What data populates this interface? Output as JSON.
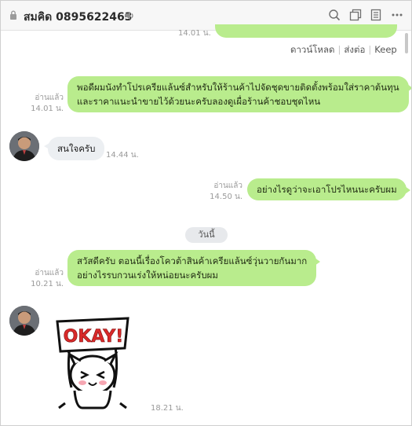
{
  "header": {
    "title": "สมคิด 0895622463",
    "icons": [
      "lock-icon",
      "speaker-icon",
      "search-icon",
      "copy-icon",
      "notes-icon",
      "more-icon"
    ]
  },
  "file_message": {
    "time": "14.01 น.",
    "actions": [
      "ดาวน์โหลด",
      "ส่งต่อ",
      "Keep"
    ]
  },
  "messages": [
    {
      "sender": "me",
      "read": "อ่านแล้ว",
      "time": "14.01 น.",
      "lines": [
        "พอดีผมนังทำโปรเครียแล้นซ์สำหรับให้ร้านค้าไปจัดชุดขายติดตั้งพร้อมใส่ราคาต้นทุน",
        "และราคาแนะนำขายไว้ด้วยนะครับลองดูเผื่อร้านค้าชอบชุดไหน"
      ]
    },
    {
      "sender": "them",
      "time": "14.44 น.",
      "lines": [
        "สนใจครับ"
      ]
    },
    {
      "sender": "me",
      "read": "อ่านแล้ว",
      "time": "14.50 น.",
      "lines": [
        "อย่างไรดูว่าจะเอาโปรไหนนะครับผม"
      ]
    },
    {
      "sender": "me",
      "read": "อ่านแล้ว",
      "time": "10.21 น.",
      "lines": [
        "สวัสดีครับ ตอนนี้เรื่องโควต้าสินค้าเครียแล้นซ์วุ่นวายกันมาก",
        "อย่างไรรบกวนเร่งให้หน่อยนะครับผม"
      ]
    },
    {
      "sender": "them",
      "time": "18.21 น.",
      "sticker": "OKAY!"
    }
  ],
  "date_divider": "วันนี้",
  "colors": {
    "my_bubble": "#b9ec8d",
    "their_bubble": "#eceff2",
    "header_bg": "#f7f7f7"
  }
}
